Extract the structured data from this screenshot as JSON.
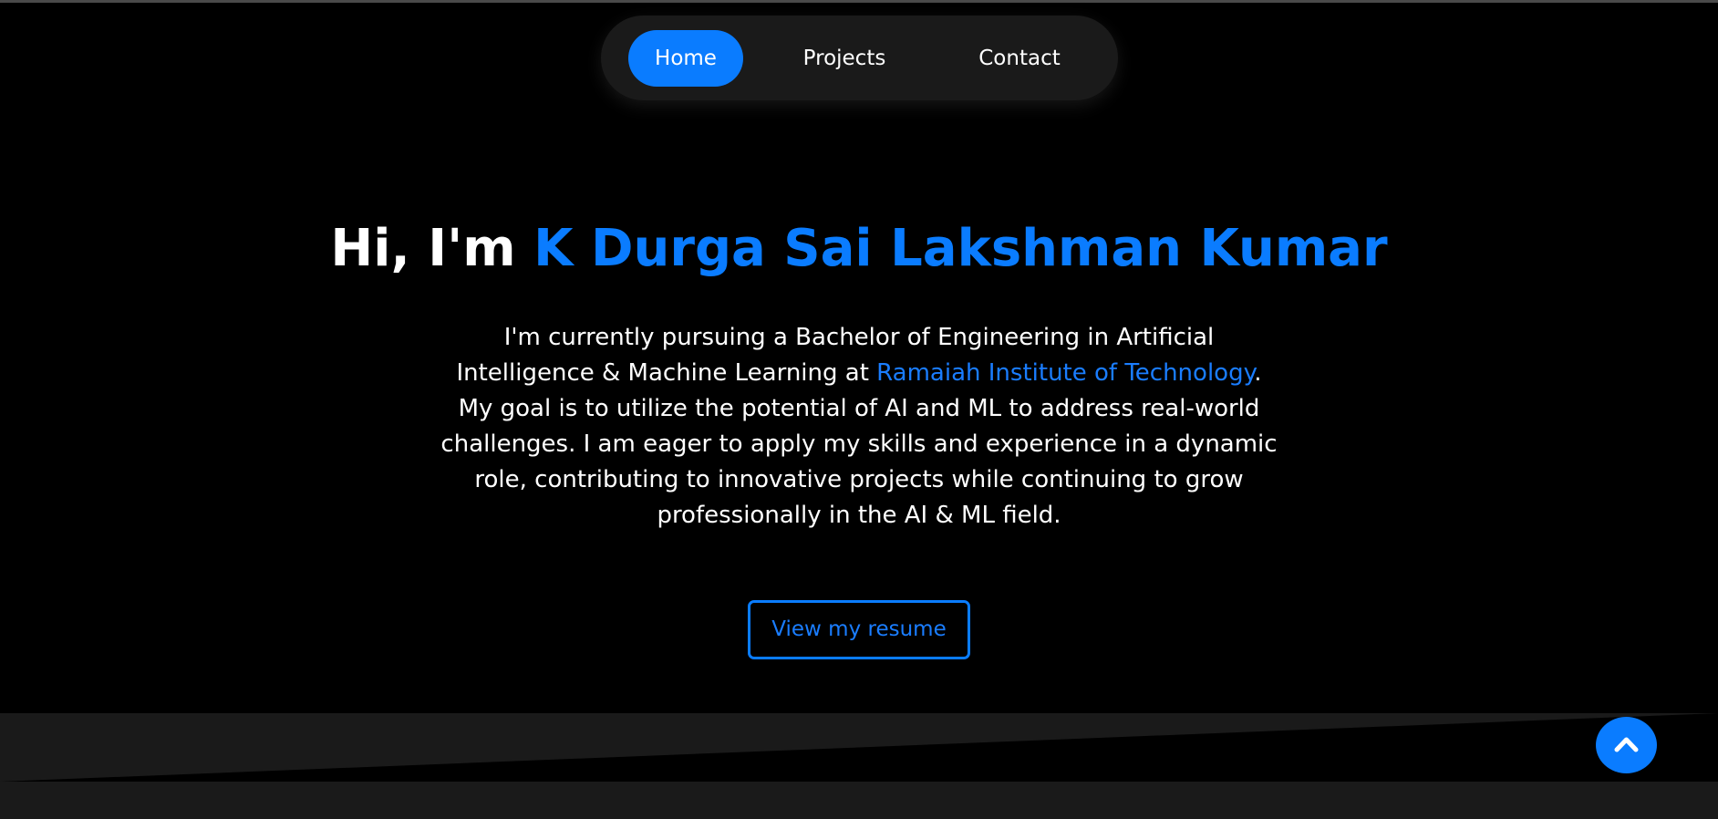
{
  "nav": {
    "items": [
      {
        "label": "Home",
        "active": true
      },
      {
        "label": "Projects",
        "active": false
      },
      {
        "label": "Contact",
        "active": false
      }
    ]
  },
  "hero": {
    "greeting": "Hi, I'm ",
    "name": "K Durga Sai Lakshman Kumar"
  },
  "bio": {
    "line1": "I'm currently pursuing a Bachelor of Engineering in Artificial",
    "line2_before": "Intelligence & Machine Learning at ",
    "institute_link": "Ramaiah Institute of Technology",
    "line2_after": ".",
    "line3": "My goal is to utilize the potential of AI and ML to address real-world",
    "line4": "challenges. I am eager to apply my skills and experience in a dynamic",
    "line5": "role, contributing to innovative projects while continuing to grow",
    "line6": "professionally in the AI & ML field."
  },
  "resume_button": {
    "label": "View my resume"
  },
  "scroll_top": {
    "icon": "chevron-up-icon"
  },
  "colors": {
    "accent": "#0a7cff",
    "background": "#000000",
    "nav_background": "#1a1a1a",
    "footer_band": "#1a1a1a",
    "text": "#ffffff"
  }
}
